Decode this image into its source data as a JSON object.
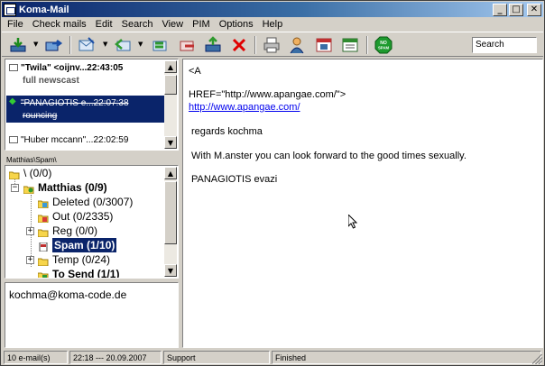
{
  "window": {
    "title": "Koma-Mail"
  },
  "window_controls": {
    "minimize": "_",
    "maximize": "□",
    "close": "✕"
  },
  "menu": [
    "File",
    "Check mails",
    "Edit",
    "Search",
    "View",
    "PIM",
    "Options",
    "Help"
  ],
  "toolbar": {
    "search_text": "Search",
    "icons": [
      "receive-mail-icon",
      "send-mail-icon",
      "new-mail-icon",
      "reply-icon",
      "reply-all-icon",
      "forward-icon",
      "attachment-icon",
      "delete-icon",
      "print-icon",
      "contacts-icon",
      "calendar-icon",
      "layout-icon",
      "no-spam-icon"
    ],
    "no_spam_label": "NO SPAM"
  },
  "message_list": [
    {
      "line1": "\"Twila\" <oijnv...22:43:05",
      "line2": "full newscast",
      "selected": false
    },
    {
      "line1": "\"PANAGIOTIS e...22:07:38",
      "line2": "rouncing",
      "selected": true
    },
    {
      "line1": "\"Huber mccann\"...22:02:59",
      "line2": "",
      "selected": false
    }
  ],
  "folder_path": "Matthias\\Spam\\",
  "folders": [
    {
      "label": "\\ (0/0)",
      "bold": true
    },
    {
      "label": "Matthias (0/9)",
      "bold": true
    },
    {
      "label": "Deleted (0/3007)",
      "bold": false
    },
    {
      "label": "Out (0/2335)",
      "bold": false
    },
    {
      "label": "Reg (0/0)",
      "bold": false
    },
    {
      "label": "Spam (1/10)",
      "bold": true,
      "selected": true
    },
    {
      "label": "Temp (0/24)",
      "bold": false
    },
    {
      "label": "To Send (1/1)",
      "bold": true
    }
  ],
  "note": {
    "text": "kochma@koma-code.de"
  },
  "message_body": {
    "line1": "<A",
    "line2": "HREF=\"http://www.apangae.com/\">",
    "link": "http://www.apangae.com/",
    "line3": "regards kochma",
    "line4": "With M.anster you can look forward to the good times sexually.",
    "line5": "PANAGIOTIS evazi"
  },
  "status": {
    "count": "10 e-mail(s)",
    "datetime": "22:18 --- 20.09.2007",
    "support": "Support",
    "state": "Finished"
  },
  "colors": {
    "title_start": "#0a246a",
    "title_end": "#a6caf0",
    "selection": "#0a246a",
    "link": "#0000ee",
    "face": "#d4d0c8"
  }
}
